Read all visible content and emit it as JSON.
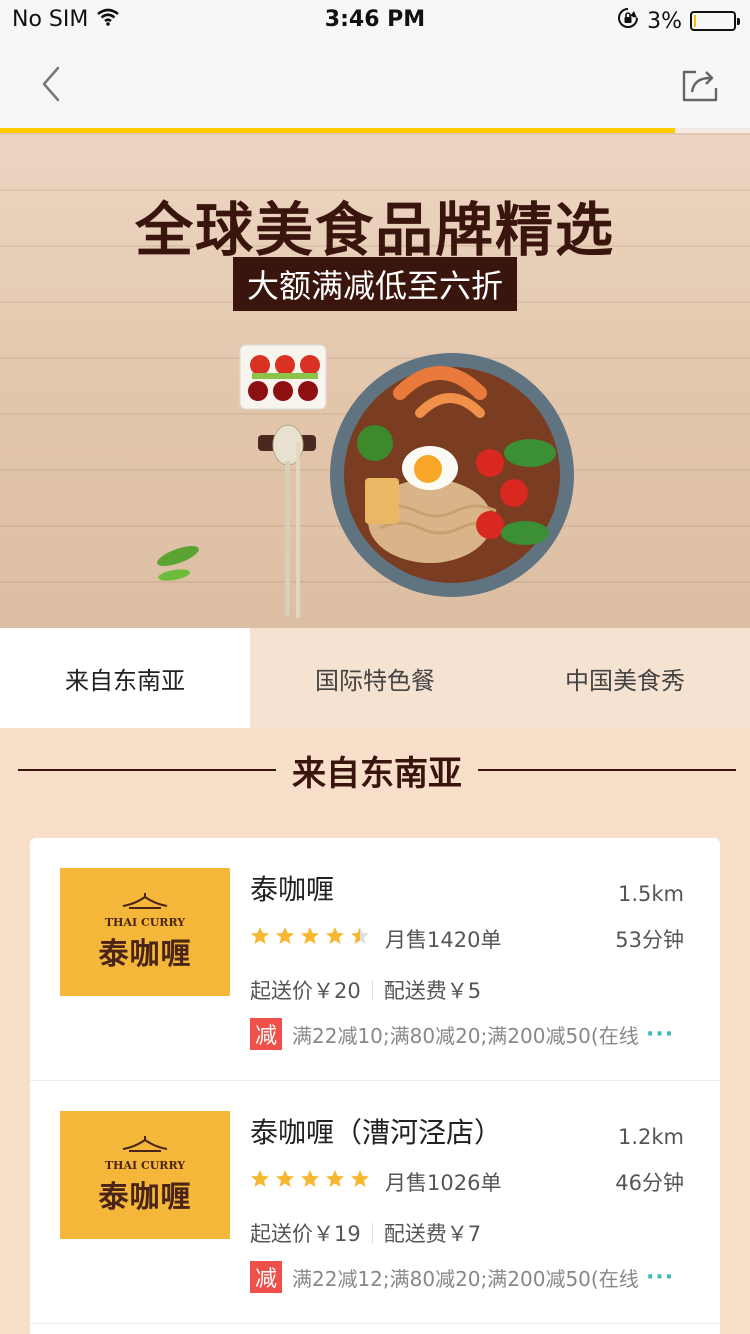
{
  "status_bar": {
    "carrier": "No SIM",
    "time": "3:46 PM",
    "battery": "3%",
    "battery_level": 0.03
  },
  "nav": {
    "back_icon": "chevron-left-icon",
    "share_icon": "share-icon",
    "load_progress": 0.9
  },
  "banner": {
    "title": "全球美食品牌精选",
    "subtitle": "大额满减低至六折"
  },
  "tabs": [
    {
      "label": "来自东南亚",
      "active": true
    },
    {
      "label": "国际特色餐",
      "active": false
    },
    {
      "label": "中国美食秀",
      "active": false
    }
  ],
  "section": {
    "title": "来自东南亚"
  },
  "shops": [
    {
      "name": "泰咖喱",
      "logo_en": "THAI CURRY",
      "logo_cn": "泰咖喱",
      "distance": "1.5km",
      "rating": 4.5,
      "sales": "月售1420单",
      "time": "53分钟",
      "min_order": "起送价￥20",
      "delivery_fee": "配送费￥5",
      "promo_badge": "减",
      "promo": "满22减10;满80减20;满200减50(在线",
      "promo_more": "···"
    },
    {
      "name": "泰咖喱（漕河泾店）",
      "logo_en": "THAI CURRY",
      "logo_cn": "泰咖喱",
      "distance": "1.2km",
      "rating": 5,
      "sales": "月售1026单",
      "time": "46分钟",
      "min_order": "起送价￥19",
      "delivery_fee": "配送费￥7",
      "promo_badge": "减",
      "promo": "满22减12;满80减20;满200减50(在线",
      "promo_more": "···"
    }
  ],
  "colors": {
    "accent": "#ffcc00",
    "brand_dark": "#3a150d",
    "promo_red": "#f0504a",
    "star": "#f7b731",
    "page_bg": "#f7dfca"
  }
}
